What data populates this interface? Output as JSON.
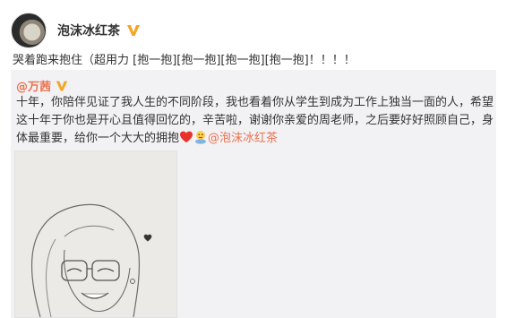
{
  "author": {
    "name": "泡沫冰红茶"
  },
  "post": {
    "text": "哭着跑来抱住（超用力 [抱一抱][抱一抱][抱一抱][抱一抱]！！！！"
  },
  "repost": {
    "user": "@万茜",
    "text": "十年，你陪伴见证了我人生的不同阶段，我也看着你从学生到成为工作上独当一面的人，希望这十年于你也是开心且值得回忆的，辛苦啦，谢谢你亲爱的周老师，之后要好好照顾自己，身体最重要，给你一个大大的拥抱",
    "mention": "@泡沫冰红茶"
  },
  "icons": {
    "verified": "verified-v-icon",
    "heart": "heart-icon",
    "hug": "hug-emoji-icon"
  },
  "colors": {
    "accent": "#eb7350",
    "badge": "#f5a623",
    "repost_bg": "#f2f2f5"
  }
}
